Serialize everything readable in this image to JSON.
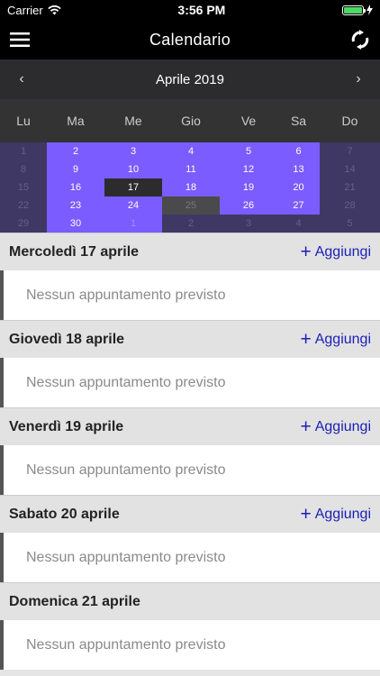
{
  "status": {
    "carrier": "Carrier",
    "time": "3:56 PM",
    "battery_level": 1.0
  },
  "navbar": {
    "title": "Calendario",
    "menu_icon": "hamburger-icon",
    "refresh_icon": "refresh-icon"
  },
  "calendar": {
    "month_label": "Aprile 2019",
    "prev": "‹",
    "next": "›",
    "weekdays": [
      "Lu",
      "Ma",
      "Me",
      "Gio",
      "Ve",
      "Sa",
      "Do"
    ],
    "rows": [
      [
        "1",
        "2",
        "3",
        "4",
        "5",
        "6",
        "7"
      ],
      [
        "8",
        "9",
        "10",
        "11",
        "12",
        "13",
        "14"
      ],
      [
        "15",
        "16",
        "17",
        "18",
        "19",
        "20",
        "21"
      ],
      [
        "22",
        "23",
        "24",
        "25",
        "26",
        "27",
        "28"
      ],
      [
        "29",
        "30",
        "1",
        "2",
        "3",
        "4",
        "5"
      ]
    ],
    "today": "17"
  },
  "days": [
    {
      "title": "Mercoledì 17 aprile",
      "add": "Aggiungi",
      "empty": "Nessun appuntamento previsto"
    },
    {
      "title": "Giovedì 18 aprile",
      "add": "Aggiungi",
      "empty": "Nessun appuntamento previsto"
    },
    {
      "title": "Venerdì 19 aprile",
      "add": "Aggiungi",
      "empty": "Nessun appuntamento previsto"
    },
    {
      "title": "Sabato 20 aprile",
      "add": "Aggiungi",
      "empty": "Nessun appuntamento previsto"
    },
    {
      "title": "Domenica 21 aprile",
      "add": "",
      "empty": "Nessun appuntamento previsto"
    }
  ],
  "colors": {
    "accent": "#7b5cff",
    "link": "#1a1fb5",
    "navbar": "#000000"
  }
}
